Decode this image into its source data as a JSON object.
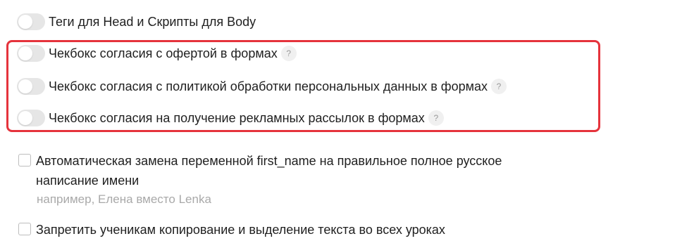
{
  "settings": {
    "toggles": [
      {
        "label": "Теги для Head и Скрипты для Body",
        "enabled": false,
        "has_help": false
      },
      {
        "label": "Чекбокс согласия с офертой в формах",
        "enabled": false,
        "has_help": true
      },
      {
        "label": "Чекбокс согласия с политикой обработки персональных данных в формах",
        "enabled": false,
        "has_help": true
      },
      {
        "label": "Чекбокс согласия на получение рекламных рассылок в формах",
        "enabled": false,
        "has_help": true
      }
    ],
    "help_glyph": "?",
    "checkboxes": [
      {
        "label_line1": "Автоматическая замена переменной first_name на правильное полное русское",
        "label_line2": "написание имени",
        "hint": "например, Елена вместо Lenka",
        "checked": false
      },
      {
        "label_line1": "Запретить ученикам копирование и выделение текста во всех уроках",
        "checked": false
      }
    ]
  },
  "colors": {
    "highlight_border": "#e5333c",
    "toggle_off": "#e6e6e6",
    "hint_text": "#a9a9a9"
  }
}
